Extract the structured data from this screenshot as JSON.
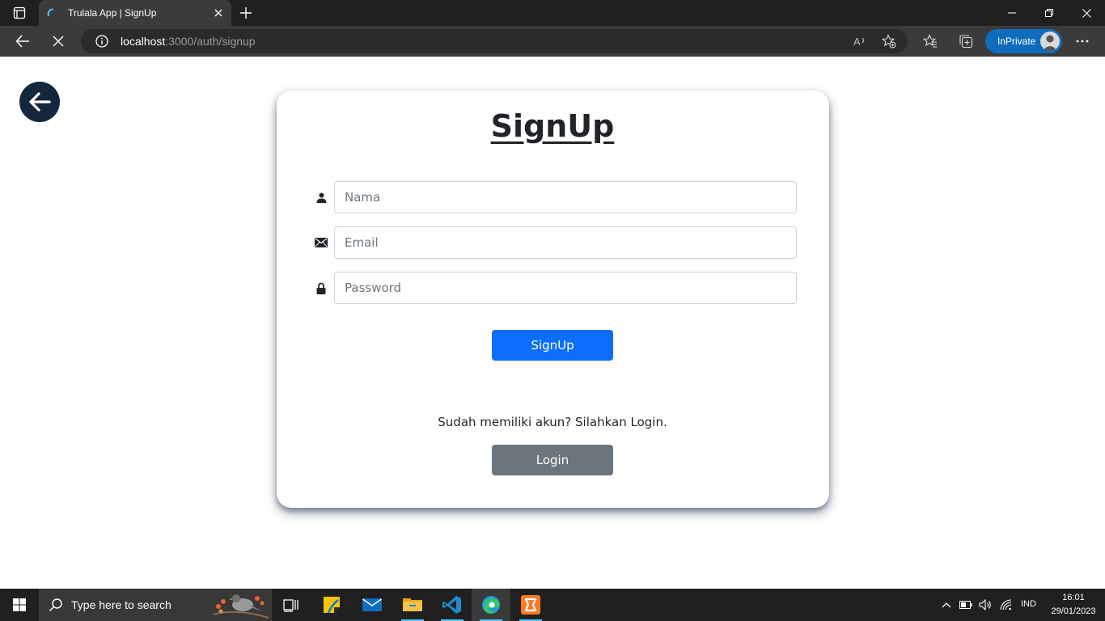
{
  "browser": {
    "tab": {
      "title": "Trulala App | SignUp",
      "favicon": "loading-spinner-icon"
    },
    "address": {
      "host": "localhost",
      "rest": ":3000/auth/signup"
    },
    "inprivate_label": "InPrivate",
    "accent": "#0f6cbd"
  },
  "page": {
    "back_icon": "arrow-left-icon",
    "title": "SignUp",
    "fields": {
      "name": {
        "icon": "user-icon",
        "placeholder": "Nama",
        "value": ""
      },
      "email": {
        "icon": "envelope-icon",
        "placeholder": "Email",
        "value": ""
      },
      "password": {
        "icon": "lock-icon",
        "placeholder": "Password",
        "value": ""
      }
    },
    "signup_button": "SignUp",
    "login_prompt": "Sudah memiliki akun? Silahkan Login.",
    "login_button": "Login",
    "colors": {
      "primary": "#0d6efd",
      "secondary": "#6c757d",
      "back_button": "#14273d"
    }
  },
  "taskbar": {
    "search_placeholder": "Type here to search",
    "apps": [
      "task-view",
      "sticky-notes",
      "mail",
      "file-explorer",
      "vscode",
      "edge",
      "xampp"
    ],
    "language": "IND",
    "time": "16:01",
    "date": "29/01/2023"
  }
}
